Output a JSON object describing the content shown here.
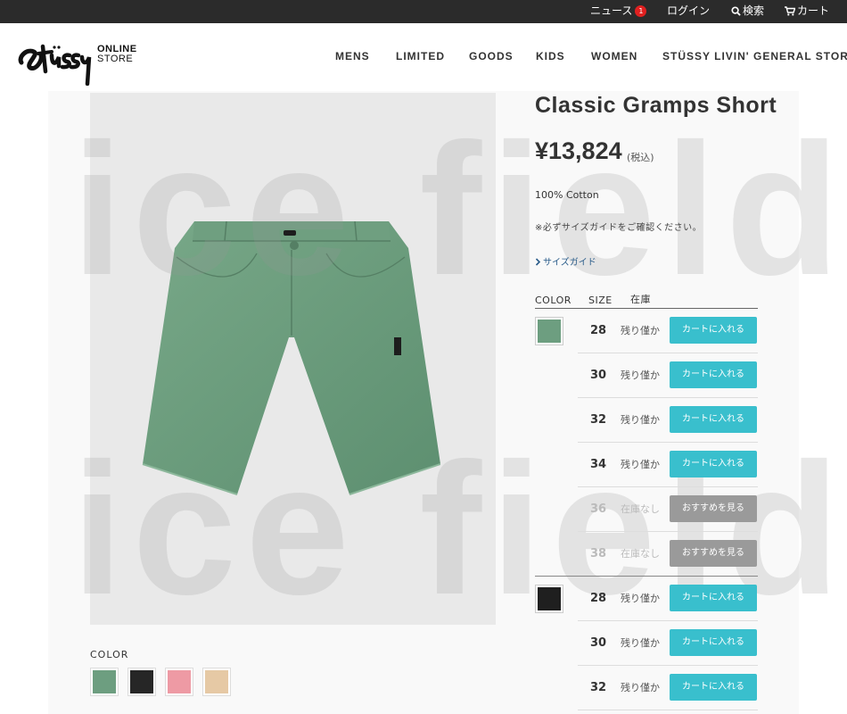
{
  "topbar": {
    "news_label": "ニュース",
    "news_count": "1",
    "login_label": "ログイン",
    "search_label": "検索",
    "cart_label": "カート"
  },
  "brand": {
    "online": "ONLINE",
    "store": "STORE"
  },
  "nav": [
    "MENS",
    "LIMITED",
    "GOODS",
    "KIDS",
    "WOMEN",
    "STÜSSY LIVIN' GENERAL STORE"
  ],
  "watermark": "ice field",
  "product": {
    "title": "Classic Gramps Short",
    "price": "¥13,824",
    "tax_note": "(税込)",
    "material": "100% Cotton",
    "size_note": "※必ずサイズガイドをご確認ください。",
    "size_guide_label": "サイズガイド"
  },
  "colors_label": "COLOR",
  "color_swatches": [
    {
      "name": "green",
      "color": "#6d9e80"
    },
    {
      "name": "black",
      "color": "#262626"
    },
    {
      "name": "pink",
      "color": "#ee9aa4"
    },
    {
      "name": "beige",
      "color": "#e6c9a5"
    }
  ],
  "table": {
    "headers": {
      "color": "COLOR",
      "size": "SIZE",
      "stock": "在庫"
    },
    "rows": [
      {
        "color": "#6d9e80",
        "size": "28",
        "stock": "残り僅か",
        "action": "カートに入れる",
        "available": true
      },
      {
        "size": "30",
        "stock": "残り僅か",
        "action": "カートに入れる",
        "available": true
      },
      {
        "size": "32",
        "stock": "残り僅か",
        "action": "カートに入れる",
        "available": true
      },
      {
        "size": "34",
        "stock": "残り僅か",
        "action": "カートに入れる",
        "available": true
      },
      {
        "size": "36",
        "stock": "在庫なし",
        "action": "おすすめを見る",
        "available": false
      },
      {
        "size": "38",
        "stock": "在庫なし",
        "action": "おすすめを見る",
        "available": false
      },
      {
        "color": "#1f1f1f",
        "size": "28",
        "stock": "残り僅か",
        "action": "カートに入れる",
        "available": true
      },
      {
        "size": "30",
        "stock": "残り僅か",
        "action": "カートに入れる",
        "available": true
      },
      {
        "size": "32",
        "stock": "残り僅か",
        "action": "カートに入れる",
        "available": true
      }
    ]
  },
  "accent_color": "#39bfcd"
}
